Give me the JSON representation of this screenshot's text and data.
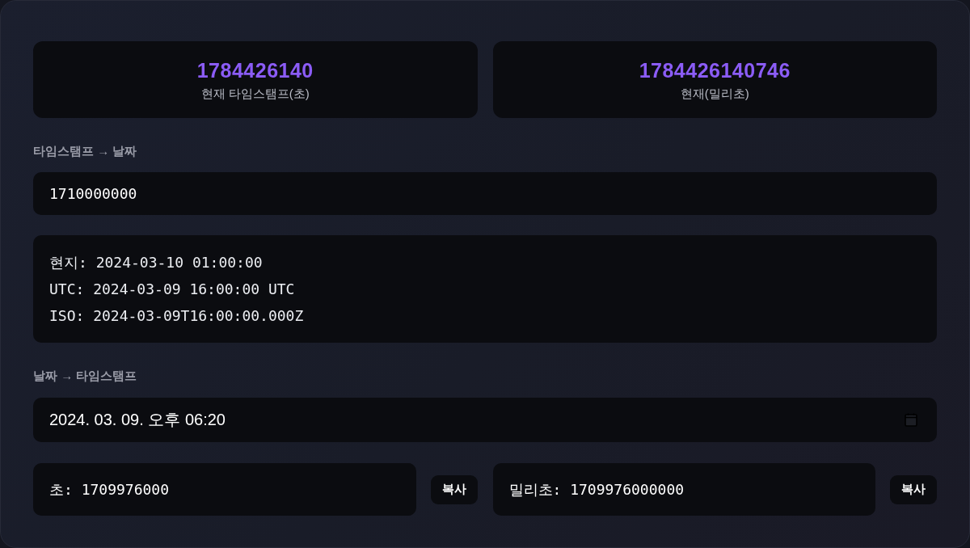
{
  "stats": [
    {
      "value": "1784426140",
      "label": "현재 타임스탬프(초)"
    },
    {
      "value": "1784426140746",
      "label": "현재(밀리초)"
    }
  ],
  "timestamp_to_date": {
    "title": "타임스탬프 → 날짜",
    "input": {
      "value": "1710000000"
    },
    "results": [
      "현지: 2024-03-10 01:00:00",
      "UTC: 2024-03-09 16:00:00 UTC",
      "ISO: 2024-03-09T16:00:00.000Z"
    ]
  },
  "date_to_timestamp": {
    "title": "날짜 → 타임스탬프",
    "date_input": {
      "value": "2024. 03. 09. 오후 06:20"
    },
    "outputs": [
      {
        "text": "초: 1709976000",
        "button": "복사"
      },
      {
        "text": "밀리초: 1709976000000",
        "button": "복사"
      }
    ]
  }
}
